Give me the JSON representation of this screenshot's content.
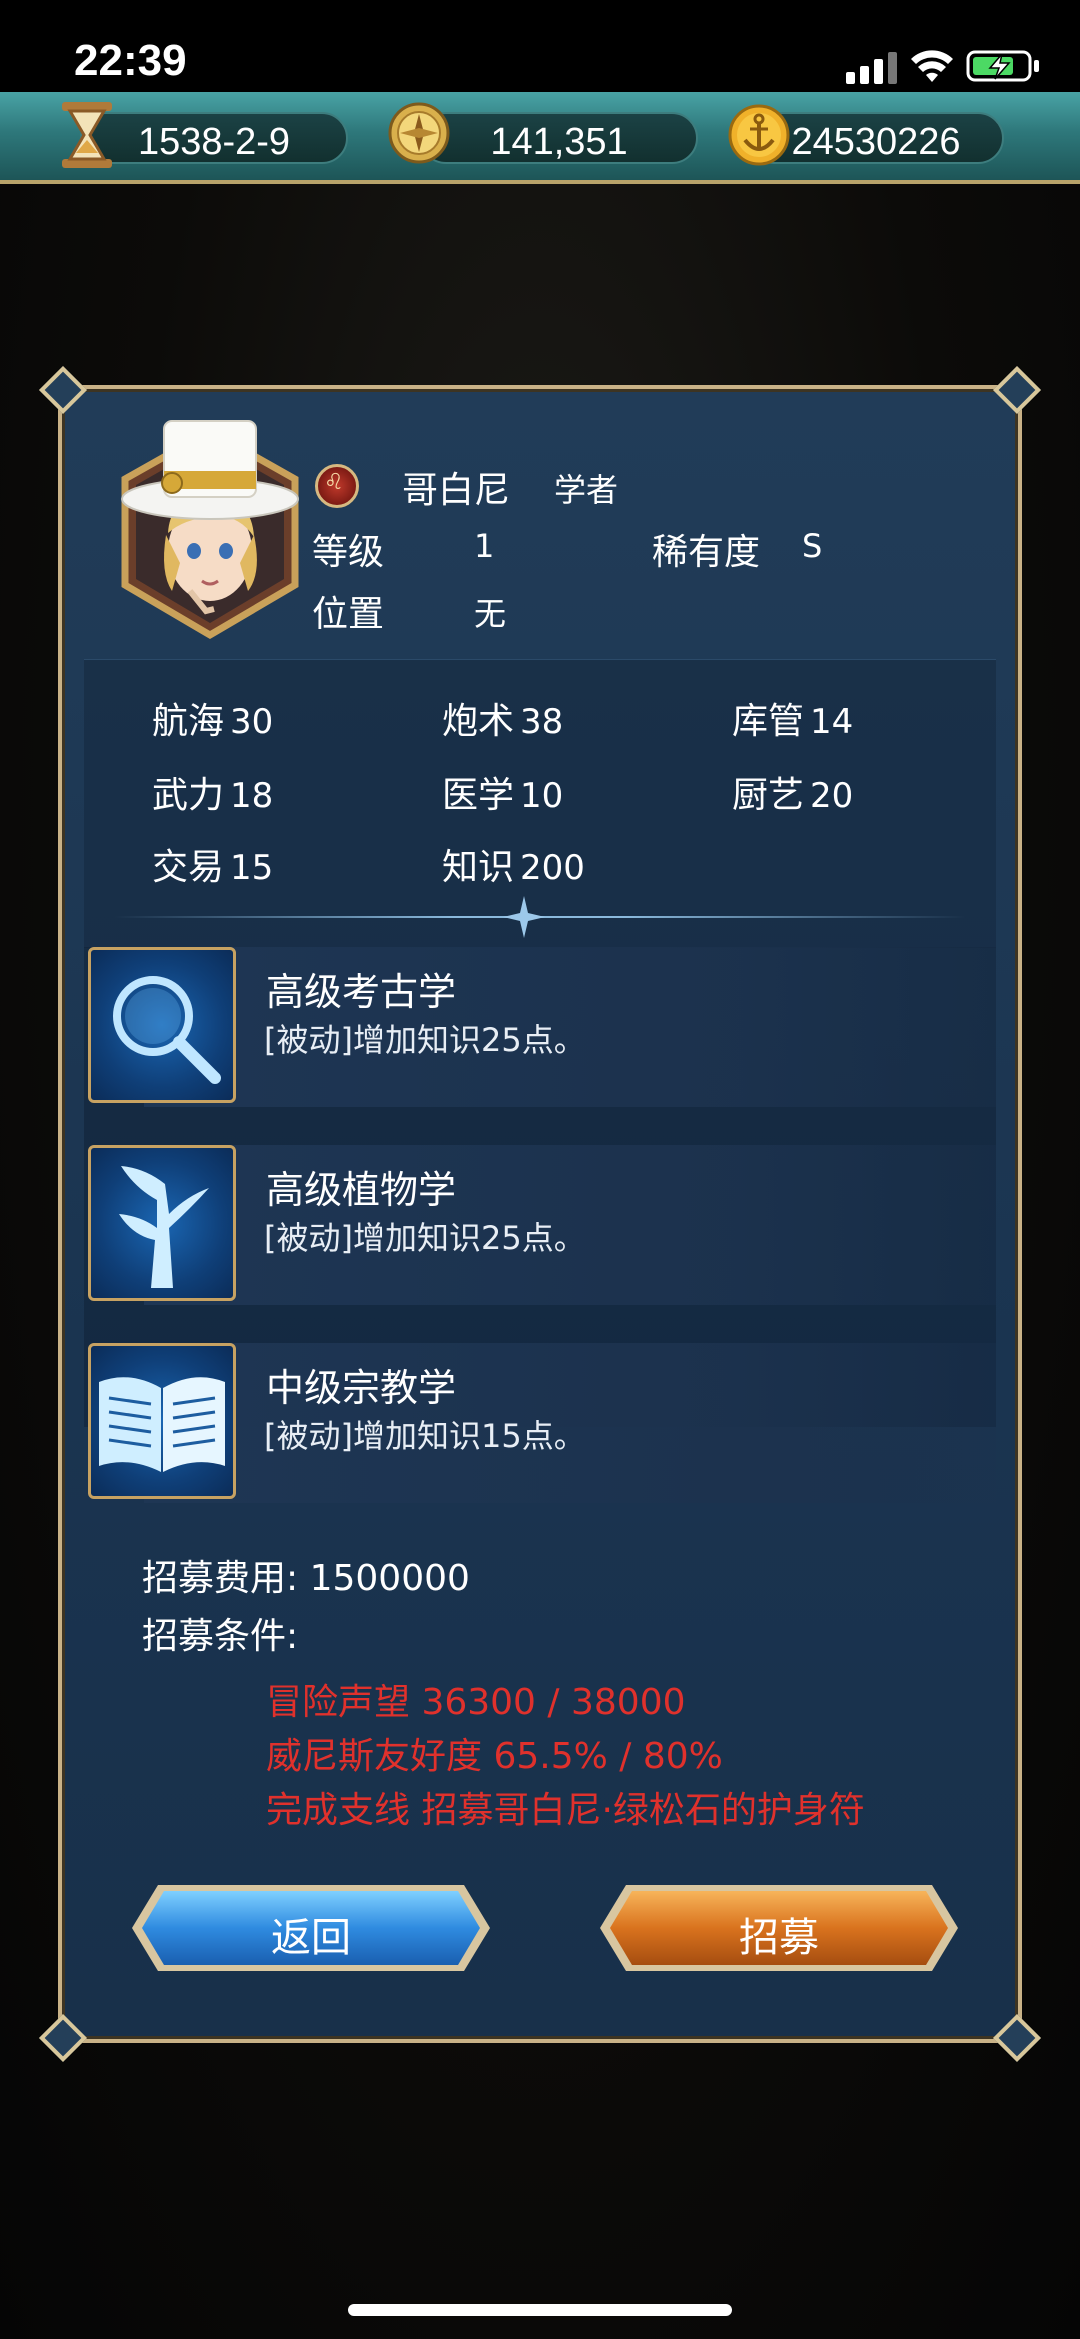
{
  "status_bar": {
    "time": "22:39"
  },
  "resources": {
    "date": {
      "value": "1538-2-9",
      "icon": "hourglass-icon"
    },
    "gold": {
      "value": "141,351",
      "icon": "compass-coin-icon"
    },
    "anchor": {
      "value": "24530226",
      "icon": "anchor-coin-icon"
    }
  },
  "character": {
    "name": "哥白尼",
    "role": "学者",
    "level_label": "等级",
    "level": "1",
    "rarity_label": "稀有度",
    "rarity": "S",
    "position_label": "位置",
    "position": "无",
    "faction_icon": "venice-lion-icon"
  },
  "stats": [
    {
      "label": "航海",
      "value": "30"
    },
    {
      "label": "炮术",
      "value": "38"
    },
    {
      "label": "库管",
      "value": "14"
    },
    {
      "label": "武力",
      "value": "18"
    },
    {
      "label": "医学",
      "value": "10"
    },
    {
      "label": "厨艺",
      "value": "20"
    },
    {
      "label": "交易",
      "value": "15"
    },
    {
      "label": "知识",
      "value": "200"
    }
  ],
  "skills": [
    {
      "name": "高级考古学",
      "desc": "[被动]增加知识25点。",
      "icon": "magnifier-icon"
    },
    {
      "name": "高级植物学",
      "desc": "[被动]增加知识25点。",
      "icon": "plant-icon"
    },
    {
      "name": "中级宗教学",
      "desc": "[被动]增加知识15点。",
      "icon": "book-icon"
    }
  ],
  "recruit": {
    "cost_text": "招募费用: 1500000",
    "conditions_label": "招募条件:",
    "conditions": [
      "冒险声望 36300 / 38000",
      "威尼斯友好度 65.5% / 80%",
      "完成支线 招募哥白尼·绿松石的护身符"
    ],
    "condition_color": "#e0312c"
  },
  "buttons": {
    "back": "返回",
    "recruit": "招募"
  }
}
